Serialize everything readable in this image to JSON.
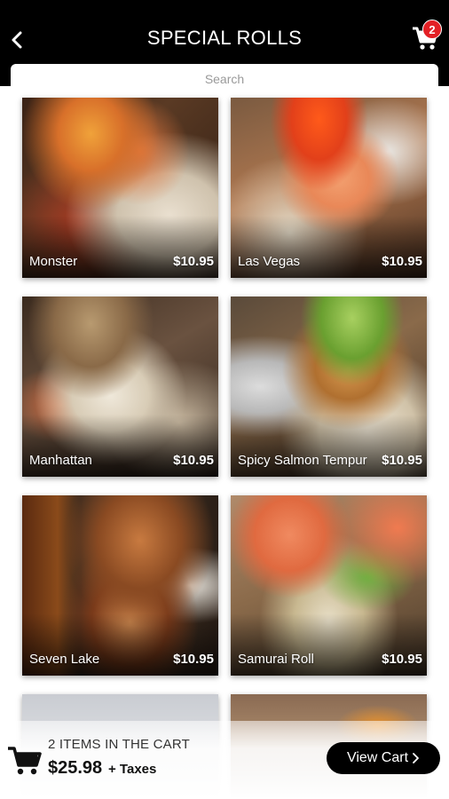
{
  "header": {
    "title": "SPECIAL ROLLS",
    "cart_count": "2"
  },
  "search": {
    "placeholder": "Search"
  },
  "menu_items": [
    {
      "name": "Monster",
      "price": "$10.95"
    },
    {
      "name": "Las Vegas",
      "price": "$10.95"
    },
    {
      "name": "Manhattan",
      "price": "$10.95"
    },
    {
      "name": "Spicy Salmon Tempur",
      "price": "$10.95"
    },
    {
      "name": "Seven Lake",
      "price": "$10.95"
    },
    {
      "name": "Samurai Roll",
      "price": "$10.95"
    }
  ],
  "cart_bar": {
    "items_text": "2 ITEMS IN THE CART",
    "total": "$25.98",
    "taxes_text": "+ Taxes",
    "view_cart_label": "View Cart"
  },
  "icons": {
    "back": "chevron-left-icon",
    "cart": "shopping-cart-icon",
    "view_cart_arrow": "chevron-right-icon"
  },
  "colors": {
    "header_bg": "#000000",
    "badge": "#e32025",
    "button_bg": "#000000"
  }
}
